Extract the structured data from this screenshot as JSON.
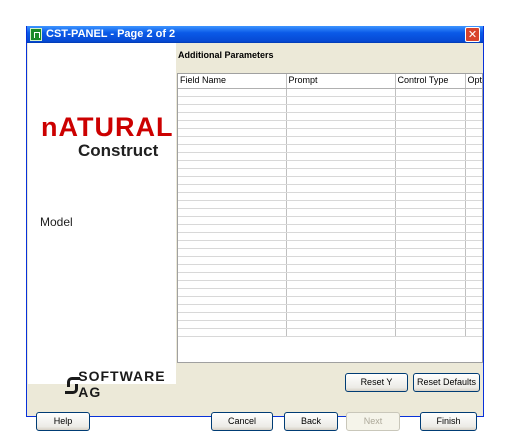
{
  "window": {
    "title": "CST-PANEL - Page 2 of 2",
    "close_glyph": "✕"
  },
  "left_panel": {
    "logo_natural": "nATURAL",
    "logo_construct": "Construct",
    "model_label": "Model",
    "vendor_logo": "SOFTWARE AG"
  },
  "section": {
    "title": "Additional Parameters"
  },
  "table": {
    "columns": [
      "Field Name",
      "Prompt",
      "Control Type",
      "Opt"
    ],
    "rows": [
      [],
      [],
      [],
      [],
      [],
      [],
      [],
      [],
      [],
      [],
      [],
      [],
      [],
      [],
      [],
      [],
      [],
      [],
      [],
      [],
      [],
      [],
      [],
      [],
      [],
      [],
      [],
      [],
      [],
      [],
      []
    ]
  },
  "buttons": {
    "reset_y": "Reset Y",
    "reset_defaults": "Reset Defaults",
    "help": "Help",
    "cancel": "Cancel",
    "back": "Back",
    "next": "Next",
    "finish": "Finish"
  }
}
